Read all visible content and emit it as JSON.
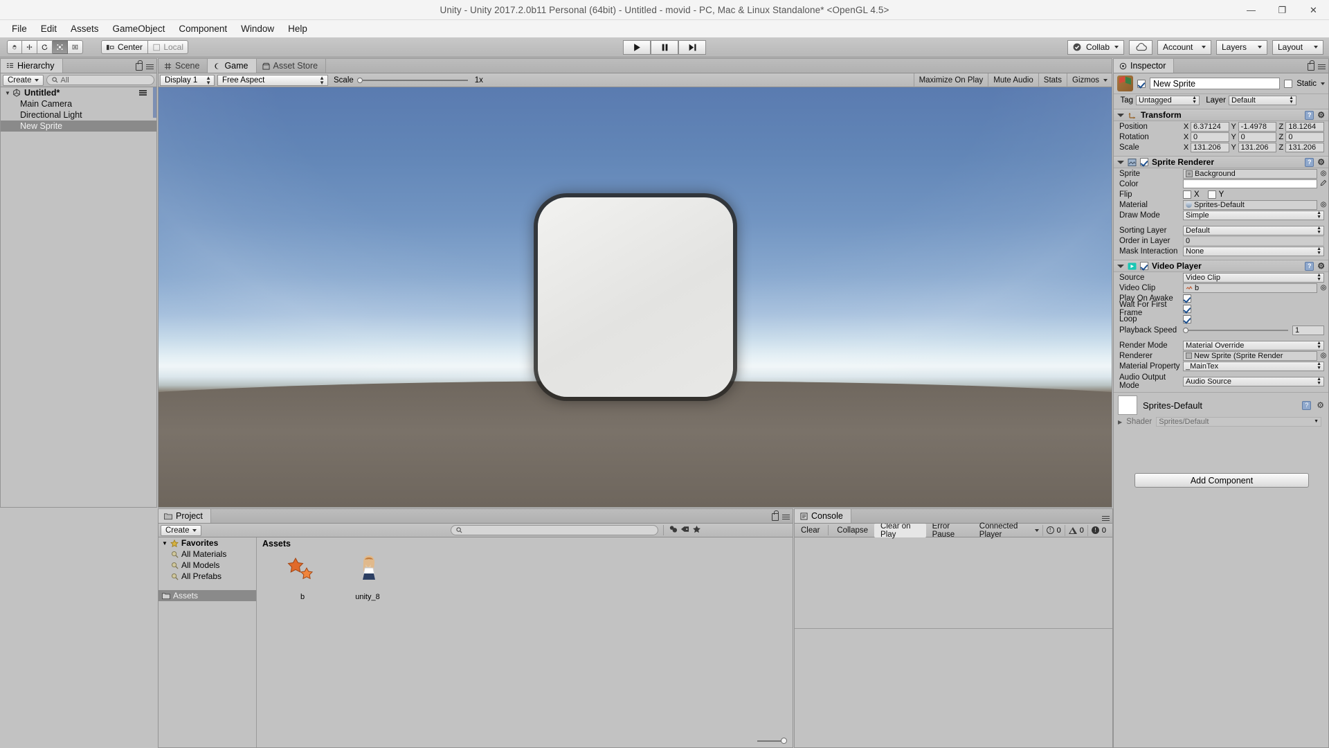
{
  "window": {
    "title": "Unity - Unity 2017.2.0b11 Personal (64bit) - Untitled - movid - PC, Mac & Linux Standalone* <OpenGL 4.5>",
    "minimize": "—",
    "maximize": "❐",
    "close": "✕"
  },
  "menubar": {
    "items": [
      "File",
      "Edit",
      "Assets",
      "GameObject",
      "Component",
      "Window",
      "Help"
    ]
  },
  "toolbar": {
    "transform_tools": [
      "hand-tool",
      "move-tool",
      "rotate-tool",
      "scale-tool",
      "rect-tool"
    ],
    "pivot_mode": "Center",
    "pivot_rotation": "Local",
    "play": "▶",
    "pause": "❙❙",
    "step": "▶|",
    "collab": "Collab",
    "cloud": "cloud-icon",
    "account": "Account",
    "layers": "Layers",
    "layout": "Layout"
  },
  "hierarchy": {
    "tab": "Hierarchy",
    "create": "Create",
    "search_placeholder": "All",
    "root": "Untitled*",
    "items": [
      {
        "label": "Main Camera",
        "selected": false
      },
      {
        "label": "Directional Light",
        "selected": false
      },
      {
        "label": "New Sprite",
        "selected": true
      }
    ]
  },
  "gameview": {
    "tabs": [
      {
        "label": "Scene",
        "icon": "grid-icon",
        "active": false
      },
      {
        "label": "Game",
        "icon": "gamepad-icon",
        "active": true
      },
      {
        "label": "Asset Store",
        "icon": "store-icon",
        "active": false
      }
    ],
    "display": "Display 1",
    "aspect": "Free Aspect",
    "scale_label": "Scale",
    "scale_value": "1x",
    "maximize_on_play": "Maximize On Play",
    "mute_audio": "Mute Audio",
    "stats": "Stats",
    "gizmos": "Gizmos"
  },
  "inspector": {
    "tab": "Inspector",
    "object_name": "New Sprite",
    "object_enabled": true,
    "static_label": "Static",
    "static_checked": false,
    "tag_label": "Tag",
    "tag_value": "Untagged",
    "layer_label": "Layer",
    "layer_value": "Default",
    "transform": {
      "title": "Transform",
      "rows": [
        {
          "label": "Position",
          "x": "6.37124",
          "y": "-1.4978",
          "z": "18.1264"
        },
        {
          "label": "Rotation",
          "x": "0",
          "y": "0",
          "z": "0"
        },
        {
          "label": "Scale",
          "x": "131.206",
          "y": "131.206",
          "z": "131.206"
        }
      ]
    },
    "sprite_renderer": {
      "title": "Sprite Renderer",
      "enabled": true,
      "sprite_label": "Sprite",
      "sprite_value": "Background",
      "color_label": "Color",
      "color_value": "#FFFFFF",
      "flip_label": "Flip",
      "flip_x": "X",
      "flip_y": "Y",
      "flip_x_checked": false,
      "flip_y_checked": false,
      "material_label": "Material",
      "material_value": "Sprites-Default",
      "draw_mode_label": "Draw Mode",
      "draw_mode_value": "Simple",
      "sorting_layer_label": "Sorting Layer",
      "sorting_layer_value": "Default",
      "order_in_layer_label": "Order in Layer",
      "order_in_layer_value": "0",
      "mask_interaction_label": "Mask Interaction",
      "mask_interaction_value": "None"
    },
    "video_player": {
      "title": "Video Player",
      "enabled": true,
      "source_label": "Source",
      "source_value": "Video Clip",
      "clip_label": "Video Clip",
      "clip_value": "b",
      "play_on_awake_label": "Play On Awake",
      "play_on_awake_checked": true,
      "wait_first_frame_label": "Wait For First Frame",
      "wait_first_frame_checked": true,
      "loop_label": "Loop",
      "loop_checked": true,
      "playback_speed_label": "Playback Speed",
      "playback_speed_value": "1",
      "render_mode_label": "Render Mode",
      "render_mode_value": "Material Override",
      "renderer_label": "Renderer",
      "renderer_value": "New Sprite (Sprite Render",
      "material_property_label": "Material Property",
      "material_property_value": "_MainTex",
      "audio_output_label": "Audio Output Mode",
      "audio_output_value": "Audio Source"
    },
    "material_preview": {
      "name": "Sprites-Default",
      "shader_label": "Shader",
      "shader_value": "Sprites/Default"
    },
    "add_component": "Add Component"
  },
  "project": {
    "tab": "Project",
    "create": "Create",
    "search_placeholder": "",
    "favorites": "Favorites",
    "favorite_items": [
      "All Materials",
      "All Models",
      "All Prefabs"
    ],
    "assets_folder": "Assets",
    "assets_header": "Assets",
    "assets": [
      {
        "label": "b",
        "type": "video-clip-stars"
      },
      {
        "label": "unity_8",
        "type": "sprite-character"
      }
    ]
  },
  "console": {
    "tab": "Console",
    "clear": "Clear",
    "collapse": "Collapse",
    "clear_on_play": "Clear on Play",
    "error_pause": "Error Pause",
    "connected_player": "Connected Player",
    "error_count": "0",
    "warning_count": "0",
    "info_count": "0"
  }
}
